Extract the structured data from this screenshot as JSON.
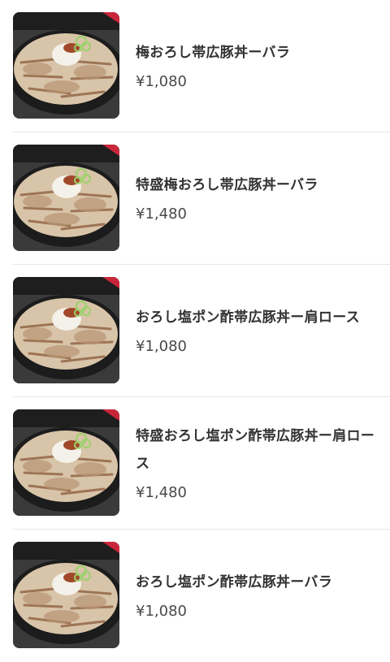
{
  "menu": {
    "items": [
      {
        "name": "梅おろし帯広豚丼ーバラ",
        "price": "¥1,080",
        "image": "pork-bowl-ume-oroshi-bara"
      },
      {
        "name": "特盛梅おろし帯広豚丼ーバラ",
        "price": "¥1,480",
        "image": "pork-bowl-tokumori-ume-oroshi-bara"
      },
      {
        "name": "おろし塩ポン酢帯広豚丼ー肩ロース",
        "price": "¥1,080",
        "image": "pork-bowl-shio-ponzu-kata-roast"
      },
      {
        "name": "特盛おろし塩ポン酢帯広豚丼ー肩ロース",
        "price": "¥1,480",
        "image": "pork-bowl-tokumori-shio-ponzu-kata-roast"
      },
      {
        "name": "おろし塩ポン酢帯広豚丼ーバラ",
        "price": "¥1,080",
        "image": "pork-bowl-shio-ponzu-bara"
      }
    ]
  }
}
